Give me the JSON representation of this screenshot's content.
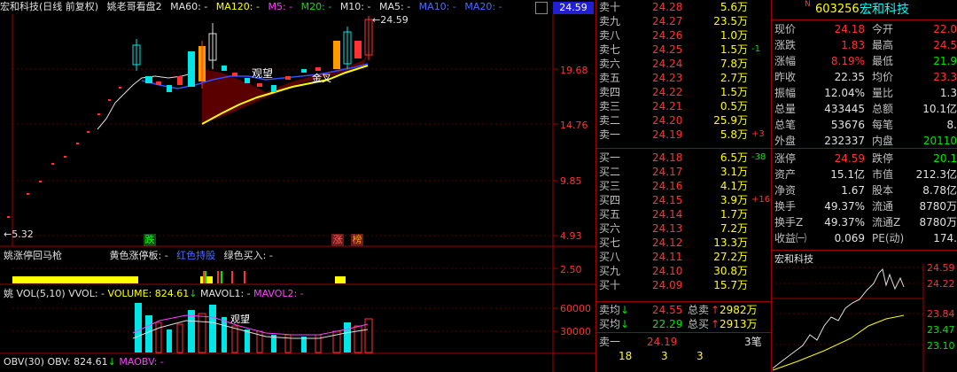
{
  "chart_header": {
    "title": "宏和科技(日线 前复权)",
    "indicator": "姚老哥看盘2",
    "ma60": "MA60: -",
    "ma120": "MA120: -",
    "m5": "M5: -",
    "m20": "M20: -",
    "m10": "M10: -",
    "ma5": "MA5: -",
    "ma10": "MA10: -",
    "ma20": "MA20: -"
  },
  "price_axis": {
    "top_value": "24.59",
    "ticks": [
      "19.68",
      "14.76",
      "9.85",
      "4.93"
    ],
    "low_label": "5.32",
    "high_label": "24.59"
  },
  "chart_annotations": {
    "label_a": "观望",
    "label_b": "观望",
    "label_c": "金叉",
    "die": "跌",
    "zhang": "涨",
    "bang": "榜"
  },
  "sub_panel_1": {
    "title": "姚涨停回马枪",
    "yellow_label": "黄色涨停板: -",
    "red_label": "红色持股",
    "green_label": "绿色买入: -",
    "axis": "2.50",
    "yellow_tag": "涨"
  },
  "vol_panel": {
    "title": "姚 VOL(5,10)",
    "vvol": "VVOL: -",
    "volume": "VOLUME: 824.61",
    "mavol1": "MAVOL1: -",
    "mavol2": "MAVOL2: -",
    "ticks": [
      "60000",
      "30000"
    ],
    "label": "观望"
  },
  "obv_panel": {
    "title": "OBV(30)",
    "obv": "OBV: 824.61",
    "maobv": "MAOBV: -"
  },
  "order_book": {
    "asks": [
      {
        "label": "卖十",
        "price": "24.28",
        "vol": "5.6万",
        "chg": ""
      },
      {
        "label": "卖九",
        "price": "24.27",
        "vol": "23.5万",
        "chg": ""
      },
      {
        "label": "卖八",
        "price": "24.26",
        "vol": "1.0万",
        "chg": ""
      },
      {
        "label": "卖七",
        "price": "24.25",
        "vol": "1.5万",
        "chg": "-1"
      },
      {
        "label": "卖六",
        "price": "24.24",
        "vol": "7.8万",
        "chg": ""
      },
      {
        "label": "卖五",
        "price": "24.23",
        "vol": "2.7万",
        "chg": ""
      },
      {
        "label": "卖四",
        "price": "24.22",
        "vol": "1.5万",
        "chg": ""
      },
      {
        "label": "卖三",
        "price": "24.21",
        "vol": "0.5万",
        "chg": ""
      },
      {
        "label": "卖二",
        "price": "24.20",
        "vol": "25.9万",
        "chg": ""
      },
      {
        "label": "卖一",
        "price": "24.19",
        "vol": "5.8万",
        "chg": "+3"
      }
    ],
    "bids": [
      {
        "label": "买一",
        "price": "24.18",
        "vol": "6.5万",
        "chg": "-38"
      },
      {
        "label": "买二",
        "price": "24.17",
        "vol": "3.1万",
        "chg": ""
      },
      {
        "label": "买三",
        "price": "24.16",
        "vol": "4.1万",
        "chg": ""
      },
      {
        "label": "买四",
        "price": "24.15",
        "vol": "3.9万",
        "chg": "+16"
      },
      {
        "label": "买五",
        "price": "24.14",
        "vol": "1.7万",
        "chg": ""
      },
      {
        "label": "买六",
        "price": "24.13",
        "vol": "7.2万",
        "chg": ""
      },
      {
        "label": "买七",
        "price": "24.12",
        "vol": "13.3万",
        "chg": ""
      },
      {
        "label": "买八",
        "price": "24.11",
        "vol": "27.2万",
        "chg": ""
      },
      {
        "label": "买九",
        "price": "24.10",
        "vol": "30.8万",
        "chg": ""
      },
      {
        "label": "买十",
        "price": "24.09",
        "vol": "15.7万",
        "chg": ""
      }
    ],
    "avg_ask_label": "卖均",
    "avg_ask": "24.55",
    "total_ask_label": "总卖",
    "total_ask": "2982万",
    "avg_bid_label": "买均",
    "avg_bid": "22.29",
    "total_bid_label": "总买",
    "total_bid": "2913万",
    "last_label": "卖一",
    "last_price": "24.19",
    "last_count": "3笔",
    "foot": [
      "18",
      "3",
      "3"
    ]
  },
  "quote": {
    "code": "603256",
    "name": "宏和科技",
    "rows": [
      [
        "现价",
        "24.18",
        "今开",
        "22.0"
      ],
      [
        "涨跌",
        "1.83",
        "最高",
        "24.5"
      ],
      [
        "涨幅",
        "8.19%",
        "最低",
        "21.9"
      ],
      [
        "昨收",
        "22.35",
        "均价",
        "23.3"
      ],
      [
        "振幅",
        "12.04%",
        "量比",
        "1.3"
      ],
      [
        "总量",
        "433445",
        "总额",
        "10.1亿"
      ],
      [
        "总笔",
        "53676",
        "每笔",
        "8."
      ],
      [
        "外盘",
        "232337",
        "内盘",
        "20110"
      ],
      [
        "涨停",
        "24.59",
        "跌停",
        "20.1"
      ],
      [
        "资产",
        "15.1亿",
        "市值",
        "212.3亿"
      ],
      [
        "净资",
        "1.67",
        "股本",
        "8.78亿"
      ],
      [
        "换手",
        "49.37%",
        "流通",
        "8780万"
      ],
      [
        "换手Z",
        "49.37%",
        "流通Z",
        "8780万"
      ],
      [
        "收益㈠",
        "0.069",
        "PE(动)",
        "174."
      ]
    ]
  },
  "intraday": {
    "title": "宏和科技",
    "ticks": [
      "24.59",
      "24.22",
      "23.84",
      "23.47",
      "23.10"
    ]
  },
  "colors": {
    "up": "#ff3232",
    "down": "#00e600",
    "volume": "#ffff00",
    "background": "#000000",
    "grid": "#a00000"
  }
}
